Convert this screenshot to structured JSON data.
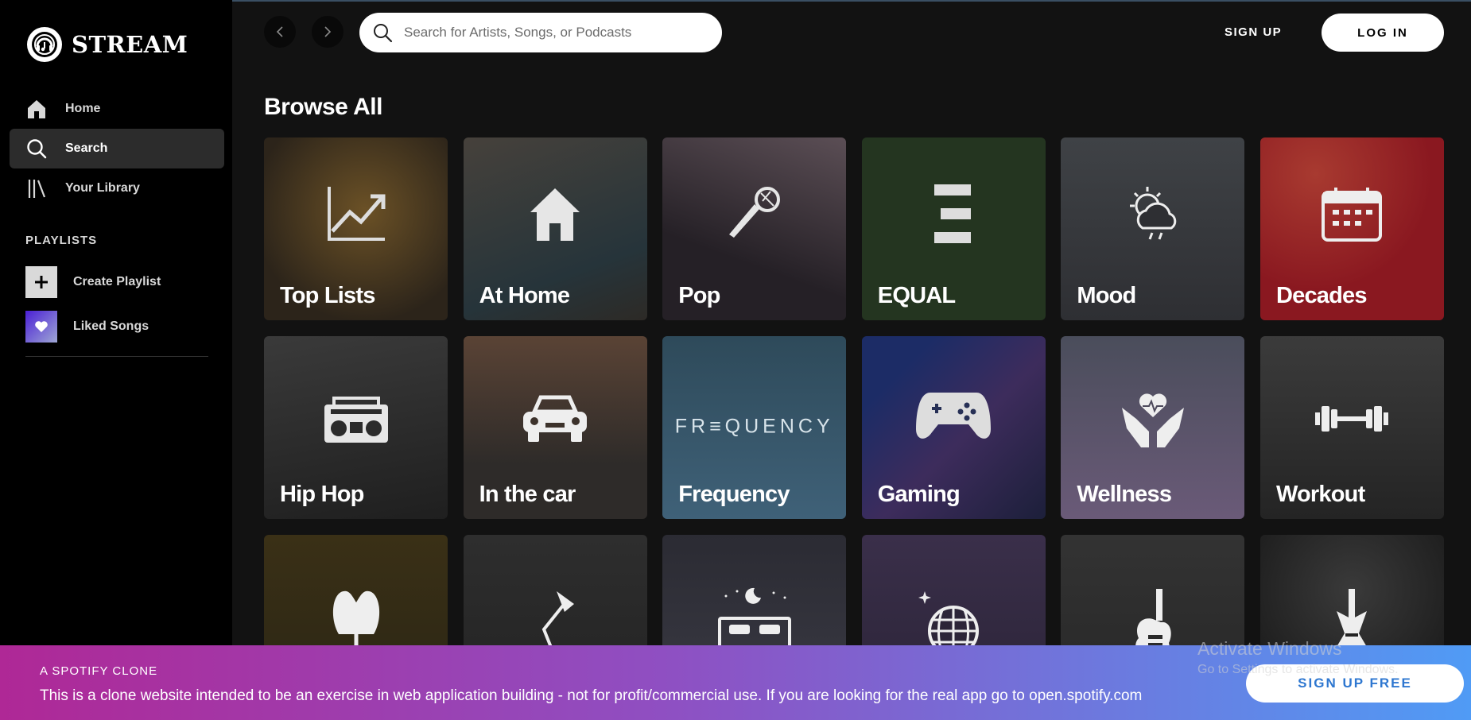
{
  "app": {
    "name": "STREAM"
  },
  "sidebar": {
    "items": [
      {
        "label": "Home",
        "icon": "home-icon"
      },
      {
        "label": "Search",
        "icon": "search-icon",
        "active": true
      },
      {
        "label": "Your Library",
        "icon": "library-icon"
      }
    ],
    "playlists_heading": "PLAYLISTS",
    "create_playlist": "Create Playlist",
    "liked_songs": "Liked Songs"
  },
  "topbar": {
    "search_placeholder": "Search for Artists, Songs, or Podcasts",
    "signup": "SIGN UP",
    "login": "LOG IN"
  },
  "main": {
    "title": "Browse All",
    "tiles": [
      {
        "label": "Top Lists",
        "icon": "trending-up-icon",
        "color": "#4a3a24"
      },
      {
        "label": "At Home",
        "icon": "house-icon",
        "color": "#35322e"
      },
      {
        "label": "Pop",
        "icon": "microphone-icon",
        "color": "#2f2a30"
      },
      {
        "label": "EQUAL",
        "icon": "equal-icon",
        "color": "#25381f"
      },
      {
        "label": "Mood",
        "icon": "weather-icon",
        "color": "#38393d"
      },
      {
        "label": "Decades",
        "icon": "calendar-icon",
        "color": "#8d1b22"
      },
      {
        "label": "Hip Hop",
        "icon": "boombox-icon",
        "color": "#2b2b2b"
      },
      {
        "label": "In the car",
        "icon": "car-icon",
        "color": "#3c322b"
      },
      {
        "label": "Frequency",
        "icon": "frequency-wordmark",
        "color": "#345467",
        "wordmark": "FR≡QUENCY"
      },
      {
        "label": "Gaming",
        "icon": "gamepad-icon",
        "color": "#262f55"
      },
      {
        "label": "Wellness",
        "icon": "heart-hands-icon",
        "color": "#4d4a5c"
      },
      {
        "label": "Workout",
        "icon": "dumbbell-icon",
        "color": "#2e2e2e"
      },
      {
        "label": "",
        "icon": "egg-chair-icon",
        "color": "#3a3016"
      },
      {
        "label": "",
        "icon": "desk-lamp-icon",
        "color": "#2a2a2a"
      },
      {
        "label": "",
        "icon": "bed-icon",
        "color": "#2b2b33"
      },
      {
        "label": "",
        "icon": "disco-ball-icon",
        "color": "#2c2538"
      },
      {
        "label": "",
        "icon": "electric-guitar-icon",
        "color": "#2a2a2a"
      },
      {
        "label": "",
        "icon": "metal-guitar-icon",
        "color": "#242424"
      }
    ]
  },
  "banner": {
    "kicker": "A SPOTIFY CLONE",
    "text": "This is a clone website intended to be an exercise in web application building - not for profit/commercial use. If you are looking for the real app go to open.spotify.com",
    "button": "SIGN UP FREE"
  },
  "watermark": {
    "line1": "Activate Windows",
    "line2": "Go to Settings to activate Windows."
  }
}
